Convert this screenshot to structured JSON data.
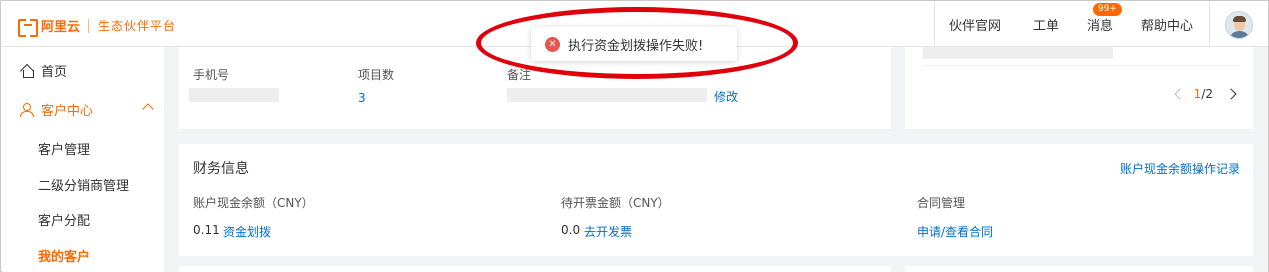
{
  "header": {
    "logo_brand": "阿里云",
    "logo_sub": "生态伙伴平台",
    "nav": {
      "partner_site": "伙伴官网",
      "ticket": "工单",
      "messages": "消息",
      "messages_badge": "99+",
      "help": "帮助中心"
    }
  },
  "sidebar": {
    "home": "首页",
    "customer_center": "客户中心",
    "items": [
      {
        "label": "客户管理"
      },
      {
        "label": "二级分销商管理"
      },
      {
        "label": "客户分配"
      },
      {
        "label": "我的客户",
        "active": true
      }
    ]
  },
  "top_card": {
    "phone_label": "手机号",
    "project_count_label": "项目数",
    "project_count": "3",
    "remark_label": "备注",
    "edit_link": "修改"
  },
  "pager": {
    "current": "1",
    "total": "/2"
  },
  "finance": {
    "title": "财务信息",
    "record_link": "账户现金余额操作记录",
    "balance_label": "账户现金余额（CNY）",
    "balance_value": "0.11",
    "transfer_link": "资金划拨",
    "invoice_label": "待开票金额（CNY）",
    "invoice_value": "0.0",
    "invoice_link": "去开发票",
    "contract_label": "合同管理",
    "contract_link": "申请/查看合同"
  },
  "toast": {
    "message": "执行资金划拨操作失败!",
    "icon": "error-circle-icon"
  },
  "colors": {
    "accent": "#ff6a00",
    "link": "#0070cc",
    "error": "#e8554e",
    "annotation": "#e0000b"
  }
}
